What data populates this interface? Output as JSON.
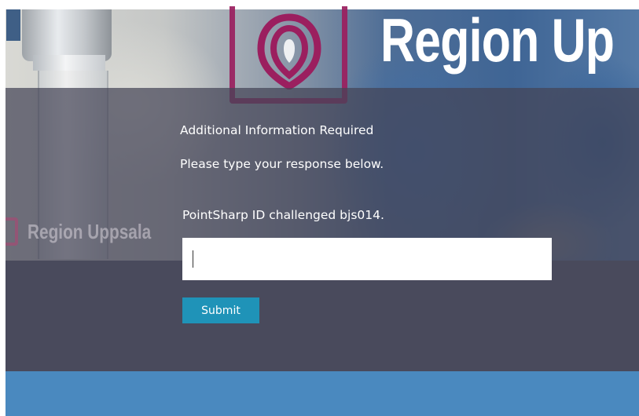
{
  "header": {
    "brand_text": "Region Up",
    "secondary_brand_text": "Region Uppsala",
    "logo_color": "#9b1f5f"
  },
  "form": {
    "title": "Additional Information Required",
    "instruction": "Please type your response below.",
    "challenge_label": "PointSharp ID challenged bjs014.",
    "response_value": "",
    "submit_label": "Submit"
  },
  "colors": {
    "submit_button": "#1f93b8",
    "footer_band": "#4a89bf",
    "overlay": "#494a5c"
  }
}
